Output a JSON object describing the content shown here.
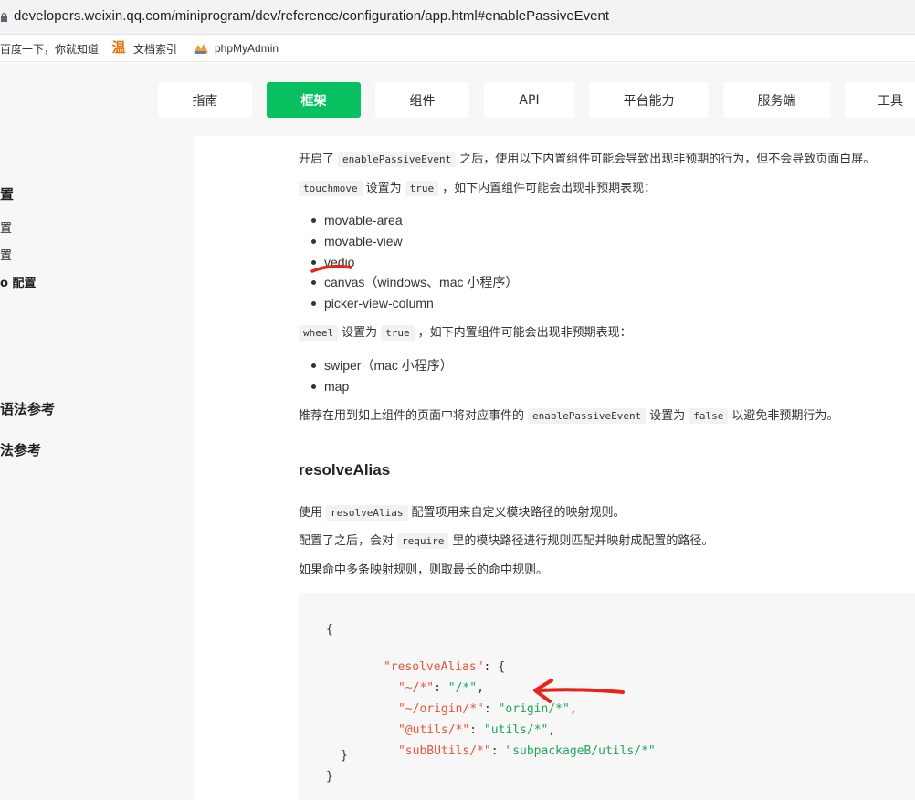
{
  "browser": {
    "url": "developers.weixin.qq.com/miniprogram/dev/reference/configuration/app.html#enablePassiveEvent",
    "bookmarks": [
      "百度一下，你就知道",
      "文档索引",
      "phpMyAdmin"
    ]
  },
  "nav": {
    "tabs": [
      {
        "label": "指南"
      },
      {
        "label": "框架"
      },
      {
        "label": "组件"
      },
      {
        "label": "API"
      },
      {
        "label": "平台能力"
      },
      {
        "label": "服务端"
      },
      {
        "label": "工具"
      }
    ],
    "active": "框架"
  },
  "sidebar": {
    "items": [
      "置",
      "置",
      "置",
      "o 配置",
      "语法参考",
      "法参考"
    ]
  },
  "content": {
    "p1": {
      "before": "开启了",
      "code": "enablePassiveEvent",
      "after": "之后，使用以下内置组件可能会导致出现非预期的行为，但不会导致页面白屏。"
    },
    "p2": {
      "code1": "touchmove",
      "mid": "设置为",
      "code2": "true",
      "after": "，如下内置组件可能会出现非预期表现："
    },
    "list1": [
      "movable-area",
      "movable-view",
      "vedio",
      "canvas（windows、mac 小程序）",
      "picker-view-column"
    ],
    "p3": {
      "code1": "wheel",
      "mid": "设置为",
      "code2": "true",
      "after": "，如下内置组件可能会出现非预期表现："
    },
    "list2": [
      "swiper（mac 小程序）",
      "map"
    ],
    "p4": {
      "before": "推荐在用到如上组件的页面中将对应事件的",
      "code1": "enablePassiveEvent",
      "mid": "设置为",
      "code2": "false",
      "after": "以避免非预期行为。"
    },
    "heading": "resolveAlias",
    "p5": {
      "before": "使用",
      "code": "resolveAlias",
      "after": "配置项用来自定义模块路径的映射规则。"
    },
    "p6": {
      "before": "配置了之后，会对",
      "code": "require",
      "after": "里的模块路径进行规则匹配并映射成配置的路径。"
    },
    "p7": "如果命中多条映射规则，则取最长的命中规则。",
    "code": {
      "open": "{",
      "key_root": "\"resolveAlias\"",
      "root_open": ": {",
      "rows": [
        {
          "k": "\"~/*\"",
          "v": "\"/*\"",
          "tail": ","
        },
        {
          "k": "\"~/origin/*\"",
          "v": "\"origin/*\"",
          "tail": ","
        },
        {
          "k": "\"@utils/*\"",
          "v": "\"utils/*\"",
          "tail": ","
        },
        {
          "k": "\"subBUtils/*\"",
          "v": "\"subpackageB/utils/*\"",
          "tail": ""
        }
      ],
      "root_close": "}",
      "close": "}"
    }
  },
  "colors": {
    "accent": "#07c160",
    "annotation": "#e8231a",
    "code_key": "#e8543a",
    "code_string": "#1ea55a"
  }
}
